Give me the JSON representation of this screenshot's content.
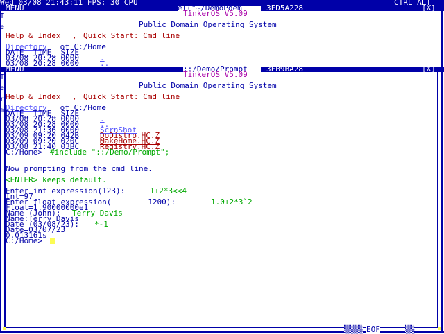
{
  "topbar": {
    "left": "Wed 03/08 21:43:11 FPS: 30 CPU",
    "right": "CTRL ALT"
  },
  "win1": {
    "menu": "MENU",
    "title": "el(\"~/DemoPoem",
    "addr": "3FD5A228",
    "close": "[X]",
    "side": [
      "T",
      "e",
      "r",
      "m"
    ],
    "os_title": "TinkerOS V5.09",
    "heading": "Public Domain Operating System",
    "help": "Help & Index",
    "quick": "Quick Start: Cmd line",
    "dir_link": "Directory",
    "dir_rest": " of C:/Home",
    "cols": "DATE_ TIME_ SIZE",
    "rows": [
      {
        "text": "03/08 20:28 0000",
        "name": "."
      },
      {
        "text": "03/08 20:28 0000",
        "name": ".."
      }
    ]
  },
  "win2": {
    "menu": "MENU",
    "title": "::/Demo/Prompt",
    "addr": "3FB9BA28",
    "close": "[X]",
    "side": [
      "T",
      "e",
      "r",
      "m"
    ],
    "os_title": "TinkerOS V5.09",
    "heading": "Public Domain Operating System",
    "help": "Help & Index",
    "quick": "Quick Start: Cmd line",
    "dir_link": "Directory",
    "dir_rest": " of C:/Home",
    "cols": "DATE_ TIME_ SIZE",
    "rows": [
      {
        "text": "03/08 20:28 0000",
        "name": ".",
        "color": "lblue"
      },
      {
        "text": "03/08 20:28 0000",
        "name": "..",
        "color": "lblue"
      },
      {
        "text": "03/08 21:36 0000",
        "name": "ScrnShot",
        "color": "lblue"
      },
      {
        "text": "03/09 09:20 042B",
        "name": "DoDistro.HC.Z",
        "color": "red"
      },
      {
        "text": "03/09 09:20 020C",
        "name": "MakeHome.HC.Z",
        "color": "red"
      },
      {
        "text": "03/08 21:40 03BC",
        "name": "Registry.HC.Z",
        "color": "red"
      }
    ],
    "prompt1": "C:/Home>",
    "cmd1": "#include \"::/Demo/Prompt\";",
    "msg1": "Now prompting from the cmd line.",
    "msg2": "<ENTER> keeps default.",
    "l1a": "Enter int expression(123):",
    "l1b": "1+2*3<<4",
    "l2": "Int=97",
    "l3a": "Enter float expression(        1200):",
    "l3b": "1.0+2*3`2",
    "l4": "Float=1.90000000e1",
    "l5a": "Name (John):",
    "l5b": "Terry Davis",
    "l6": "Name:Terry Davis",
    "l7a": "Date (03/08/23):",
    "l7b": "*-1",
    "l8": "Date=03/07/23",
    "l9": "0.013161s",
    "prompt2": "C:/Home>"
  },
  "bottom": {
    "dots_left": "▒▒▒▒",
    "eof": "EOF",
    "dots_right": "▒▒"
  },
  "colors": {
    "blue": "#0000a8",
    "red": "#a80000",
    "purple": "#a800a8",
    "green": "#00a800",
    "light_blue": "#5454fc",
    "yellow": "#fcfc54"
  }
}
